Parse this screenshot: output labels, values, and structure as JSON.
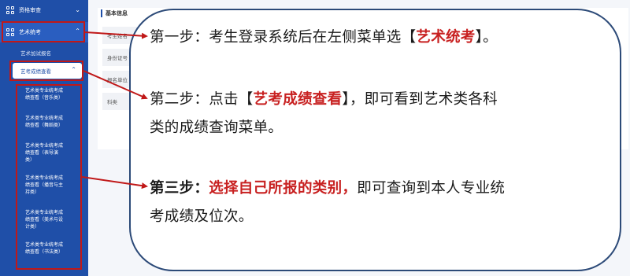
{
  "sidebar": {
    "menu_review": "资格审查",
    "menu_arts": "艺术统考",
    "sub_label": "艺术加试报名",
    "select_label": "艺考成绩查看",
    "children": [
      {
        "line1": "艺术类专业统考成",
        "line2": "绩查看（音乐类）"
      },
      {
        "line1": "艺术类专业统考成",
        "line2": "绩查看（舞蹈类）"
      },
      {
        "line1": "艺术类专业统考成",
        "line2": "绩查看（表导演",
        "line3": "类）"
      },
      {
        "line1": "艺术类专业统考成",
        "line2": "绩查看（播音与主",
        "line3": "持类）"
      },
      {
        "line1": "艺术类专业统考成",
        "line2": "绩查看（美术与设",
        "line3": "计类）"
      },
      {
        "line1": "艺术类专业统考成",
        "line2": "绩查看（书法类）"
      }
    ]
  },
  "background": {
    "card_title": "基本信息",
    "fields": [
      "考生姓名",
      "身份证号",
      "报名单位",
      "科类"
    ]
  },
  "steps": {
    "step1": {
      "prefix": "第一步：",
      "text": "考生登录系统后在左侧菜单选【",
      "highlight": "艺术统考",
      "suffix": "】。"
    },
    "step2": {
      "prefix": "第二步：",
      "text": "点击【",
      "highlight": "艺考成绩查看",
      "suffix": "】，即可看到艺术类各科",
      "line2": "类的成绩查询菜单。"
    },
    "step3": {
      "prefix": "第三步：",
      "highlight": "选择自己所报的类别，",
      "suffix": "即可查询到本人专业统",
      "line2": "考成绩及位次。"
    }
  },
  "colors": {
    "sidebar": "#1f4fa8",
    "highlight": "#c82121",
    "bubble_border": "#2c4a78"
  }
}
